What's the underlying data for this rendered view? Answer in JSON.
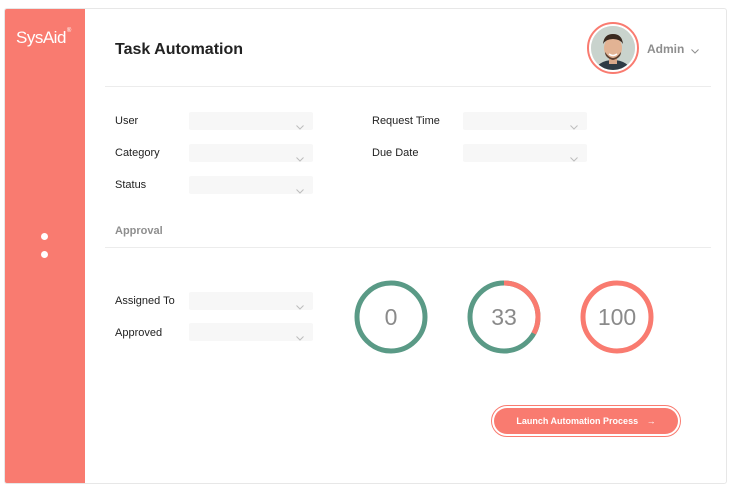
{
  "brand": {
    "logo_text": "SysAid",
    "logo_mark": "®",
    "accent": "#f97b70",
    "teal": "#5a9a86"
  },
  "header": {
    "title": "Task Automation",
    "user_name": "Admin"
  },
  "filters": {
    "user_label": "User",
    "category_label": "Category",
    "status_label": "Status",
    "request_time_label": "Request Time",
    "due_date_label": "Due Date"
  },
  "approval": {
    "section_title": "Approval",
    "assigned_to_label": "Assigned To",
    "approved_label": "Approved"
  },
  "metrics": [
    {
      "value": "0",
      "progress": 0
    },
    {
      "value": "33",
      "progress": 0.33
    },
    {
      "value": "100",
      "progress": 1.0
    }
  ],
  "actions": {
    "launch_label": "Launch Automation Process",
    "launch_arrow": "→"
  }
}
